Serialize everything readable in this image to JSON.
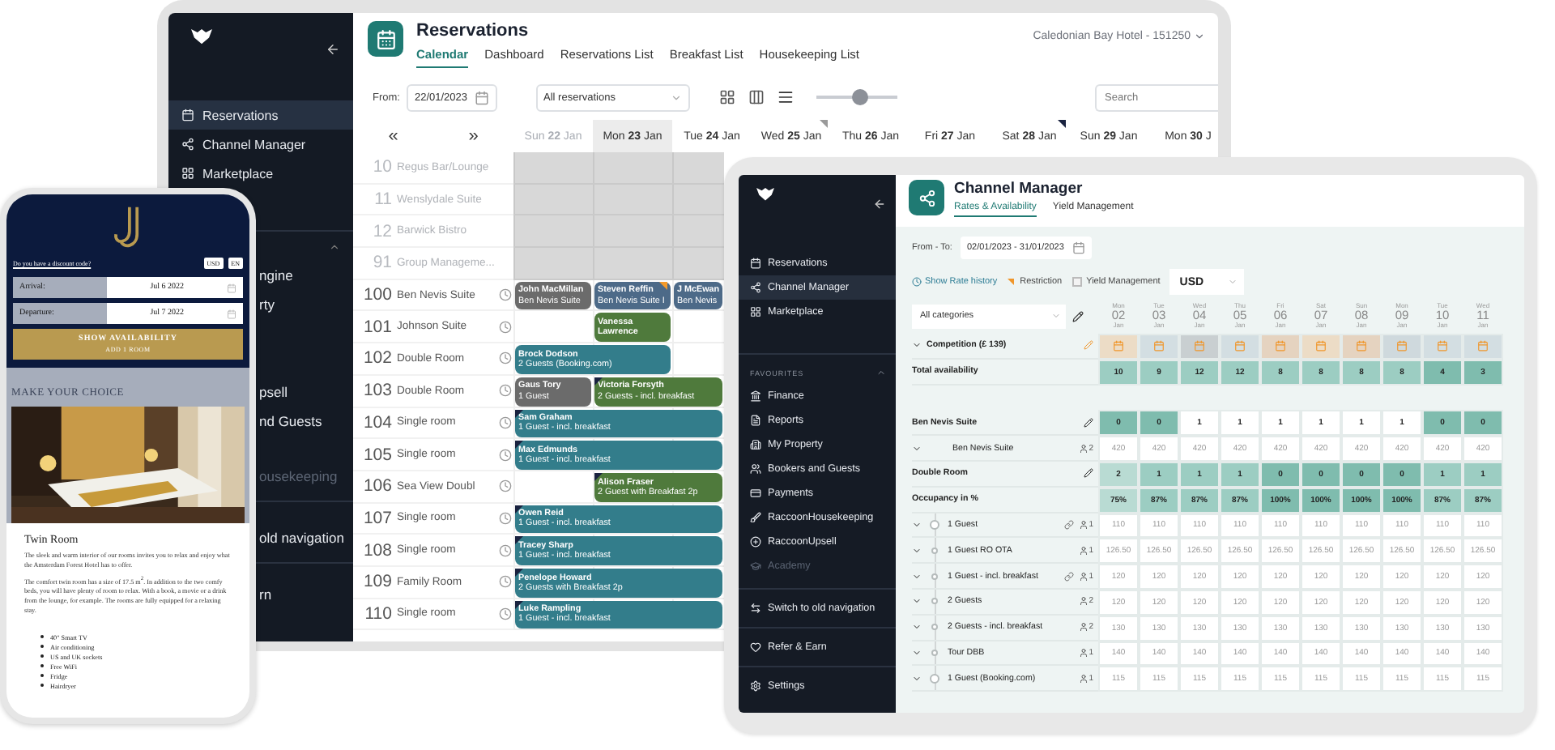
{
  "laptop": {
    "sidebar": {
      "items": [
        {
          "label": "Reservations",
          "selected": true
        },
        {
          "label": "Channel Manager",
          "selected": false
        },
        {
          "label": "Marketplace",
          "selected": false
        }
      ],
      "covered_items": [
        {
          "label": "ngine",
          "disabled": false
        },
        {
          "label": "rty",
          "disabled": false
        },
        {
          "label": "psell",
          "disabled": false
        },
        {
          "label": "nd Guests",
          "disabled": false
        },
        {
          "label": "ousekeeping",
          "disabled": true
        },
        {
          "label": "old navigation",
          "disabled": false
        },
        {
          "label": "rn",
          "disabled": false
        }
      ]
    },
    "header": {
      "title": "Reservations",
      "hotel": "Caledonian Bay Hotel - 151250",
      "tabs": [
        {
          "label": "Calendar",
          "selected": true
        },
        {
          "label": "Dashboard",
          "selected": false
        },
        {
          "label": "Reservations List",
          "selected": false
        },
        {
          "label": "Breakfast List",
          "selected": false
        },
        {
          "label": "Housekeeping List",
          "selected": false
        }
      ]
    },
    "toolbar": {
      "from_label": "From:",
      "date": "22/01/2023",
      "filter": "All reservations",
      "zoom": {
        "level": 0.55
      },
      "search": {
        "placeholder": "Search"
      }
    },
    "nav": {
      "prev": "«",
      "next": "»"
    },
    "days": [
      {
        "label": "Sun **22** Jan",
        "selected": false,
        "disabled": true
      },
      {
        "label": "Mon **23** Jan",
        "selected": true,
        "disabled": false
      },
      {
        "label": "Tue **24** Jan",
        "selected": false,
        "disabled": false
      },
      {
        "label": "Wed **25** Jan",
        "selected": false,
        "disabled": false,
        "corner": {
          "color": "#9a9a9a"
        }
      },
      {
        "label": "Thu **26** Jan",
        "selected": false,
        "disabled": false
      },
      {
        "label": "Fri **27** Jan",
        "selected": false,
        "disabled": false
      },
      {
        "label": "Sat **28** Jan",
        "selected": false,
        "disabled": false,
        "corner": {
          "color": "#1a2340"
        }
      },
      {
        "label": "Sun **29** Jan",
        "selected": false,
        "disabled": false
      },
      {
        "label": "Mon **30** J",
        "selected": false,
        "disabled": false
      }
    ],
    "rooms": [
      {
        "number": "10",
        "name": "Regus Bar/Lounge",
        "disabled": true
      },
      {
        "number": "11",
        "name": "Wenslydale Suite",
        "disabled": true
      },
      {
        "number": "12",
        "name": "Barwick Bistro",
        "disabled": true
      },
      {
        "number": "91",
        "name": "Group Manageme...",
        "disabled": true
      },
      {
        "number": "100",
        "name": "Ben Nevis Suite",
        "disabled": false,
        "bookings": [
          {
            "guest": "John MacMillan",
            "detail": "Ben Nevis Suite",
            "color": "#6b6b6b",
            "kind": "day1",
            "two_days": false,
            "open_ended": false
          },
          {
            "guest": "Steven Reffin",
            "detail": "Ben Nevis Suite I",
            "color": "#4d6a88",
            "kind": "day2",
            "two_days": false,
            "open_ended": false,
            "flag": {
              "color": "#f39a2b"
            }
          },
          {
            "guest": "J McEwan",
            "detail": "Ben Nevis",
            "color": "#4d6a88",
            "kind": "day3"
          }
        ]
      },
      {
        "number": "101",
        "name": "Johnson Suite",
        "disabled": false,
        "bookings": [
          {
            "guest": "Vanessa Lawrence",
            "color": "#4f7a3c",
            "kind": "day2",
            "two_days": false,
            "open_ended": false
          }
        ]
      },
      {
        "number": "102",
        "name": "Double Room",
        "disabled": false,
        "bookings": [
          {
            "guest": "Brock Dodson",
            "detail": "2 Guests (Booking.com)",
            "color": "#337d8b",
            "kind": "day1",
            "two_days": true,
            "open_ended": false
          }
        ]
      },
      {
        "number": "103",
        "name": "Double Room",
        "disabled": false,
        "bookings": [
          {
            "guest": "Gaus Tory",
            "detail": "1 Guest",
            "color": "#6b6b6b",
            "kind": "day1",
            "two_days": false,
            "open_ended": false
          },
          {
            "guest": "Victoria Forsyth",
            "detail": "2 Guests - incl. breakfast",
            "color": "#4f7a3c",
            "kind": "day2",
            "open_ended": true,
            "flag": {
              "color": "#1a2340"
            }
          }
        ]
      },
      {
        "number": "104",
        "name": "Single room",
        "disabled": false,
        "bookings": [
          {
            "guest": "Sam Graham",
            "detail": "1 Guest - incl. breakfast",
            "color": "#337d8b",
            "kind": "day1",
            "open_ended": true,
            "flag": {
              "color": "#1a2340"
            }
          }
        ]
      },
      {
        "number": "105",
        "name": "Single room",
        "disabled": false,
        "bookings": [
          {
            "guest": "Max Edmunds",
            "detail": "1 Guest - incl. breakfast",
            "color": "#337d8b",
            "kind": "day1",
            "open_ended": true,
            "flag": {
              "color": "#1a2340"
            }
          }
        ]
      },
      {
        "number": "106",
        "name": "Sea View Doubl",
        "disabled": false,
        "bookings": [
          {
            "guest": "Alison Fraser",
            "detail": "2 Guest with Breakfast 2p",
            "color": "#4f7a3c",
            "kind": "day2",
            "open_ended": true,
            "flag": {
              "color": "#1a2340"
            }
          }
        ]
      },
      {
        "number": "107",
        "name": "Single room",
        "disabled": false,
        "bookings": [
          {
            "guest": "Owen Reid",
            "detail": "1 Guest - incl. breakfast",
            "color": "#337d8b",
            "kind": "day1",
            "open_ended": true,
            "flag": {
              "color": "#1a2340"
            }
          }
        ]
      },
      {
        "number": "108",
        "name": "Single room",
        "disabled": false,
        "bookings": [
          {
            "guest": "Tracey Sharp",
            "detail": "1 Guest - incl. breakfast",
            "color": "#337d8b",
            "kind": "day1",
            "open_ended": true,
            "flag": {
              "color": "#1a2340"
            }
          }
        ]
      },
      {
        "number": "109",
        "name": "Family Room",
        "disabled": false,
        "bookings": [
          {
            "guest": "Penelope Howard",
            "detail": "2 Guests with Breakfast 2p",
            "color": "#337d8b",
            "kind": "day1",
            "open_ended": true,
            "flag": {
              "color": "#1a2340"
            }
          }
        ]
      },
      {
        "number": "110",
        "name": "Single room",
        "disabled": false,
        "bookings": [
          {
            "guest": "Luke Rampling",
            "detail": "1 Guest - incl. breakfast",
            "color": "#337d8b",
            "kind": "day1",
            "open_ended": true,
            "flag": {
              "color": "#1a2340"
            }
          }
        ]
      }
    ]
  },
  "tablet": {
    "sidebar": {
      "items": [
        {
          "label": "Reservations",
          "selected": false
        },
        {
          "label": "Channel Manager",
          "selected": true
        },
        {
          "label": "Marketplace",
          "selected": false
        }
      ],
      "section": "FAVOURITES",
      "favourites": [
        {
          "label": "Finance",
          "disabled": false
        },
        {
          "label": "Reports",
          "disabled": false
        },
        {
          "label": "My Property",
          "disabled": false
        },
        {
          "label": "Bookers and Guests",
          "disabled": false
        },
        {
          "label": "Payments",
          "disabled": false
        },
        {
          "label": "RaccoonHousekeeping",
          "disabled": false
        },
        {
          "label": "RaccoonUpsell",
          "disabled": false
        },
        {
          "label": "Academy",
          "disabled": true
        }
      ],
      "footer": [
        {
          "label": "Switch to old navigation"
        },
        {
          "label": "Refer & Earn"
        },
        {
          "label": "Settings"
        }
      ]
    },
    "header": {
      "title": "Channel Manager",
      "tabs": [
        {
          "label": "Rates & Availability",
          "selected": true
        },
        {
          "label": "Yield Management",
          "selected": false
        }
      ]
    },
    "filters": {
      "range_label": "From - To:",
      "range": "02/01/2023 - 31/01/2023",
      "history_link": "Show Rate history",
      "restriction": "Restriction",
      "yield": {
        "label": "Yield Management",
        "checked": false
      },
      "currency": "USD"
    },
    "table": {
      "category": "All categories",
      "days": [
        {
          "weekday": "Mon",
          "day": "02",
          "month": "Jan"
        },
        {
          "weekday": "Tue",
          "day": "03",
          "month": "Jan"
        },
        {
          "weekday": "Wed",
          "day": "04",
          "month": "Jan"
        },
        {
          "weekday": "Thu",
          "day": "05",
          "month": "Jan"
        },
        {
          "weekday": "Fri",
          "day": "06",
          "month": "Jan"
        },
        {
          "weekday": "Sat",
          "day": "07",
          "month": "Jan"
        },
        {
          "weekday": "Sun",
          "day": "08",
          "month": "Jan"
        },
        {
          "weekday": "Mon",
          "day": "09",
          "month": "Jan"
        },
        {
          "weekday": "Tue",
          "day": "10",
          "month": "Jan"
        },
        {
          "weekday": "Wed",
          "day": "11",
          "month": "Jan"
        }
      ],
      "competition": {
        "label": "Competition (£ 139)",
        "cells": [
          {
            "color": "#ecdcc6"
          },
          {
            "color": "#d3dee2"
          },
          {
            "color": "#c9cfd1"
          },
          {
            "color": "#d3dee2"
          },
          {
            "color": "#e5d3c0"
          },
          {
            "color": "#ecdcc6"
          },
          {
            "color": "#e5d3c0"
          },
          {
            "color": "#cfd9dd"
          },
          {
            "color": "#d3dee2"
          },
          {
            "color": "#d3dee2"
          }
        ]
      },
      "rows": [
        {
          "kind": "total",
          "label": "Total availability",
          "cells": [
            {
              "text": "10",
              "color": "#9ccdc2"
            },
            {
              "text": "9",
              "color": "#9ccdc2"
            },
            {
              "text": "12",
              "color": "#9ccdc2"
            },
            {
              "text": "12",
              "color": "#9ccdc2"
            },
            {
              "text": "8",
              "color": "#9ccdc2"
            },
            {
              "text": "8",
              "color": "#9ccdc2"
            },
            {
              "text": "8",
              "color": "#9ccdc2"
            },
            {
              "text": "8",
              "color": "#9ccdc2"
            },
            {
              "text": "4",
              "color": "#7fbcae"
            },
            {
              "text": "3",
              "color": "#7fbcae"
            }
          ]
        },
        {
          "kind": "room",
          "label": "Ben Nevis Suite",
          "cells": [
            {
              "text": "0",
              "color": "#7fbcae"
            },
            {
              "text": "0",
              "color": "#7fbcae"
            },
            {
              "text": "1",
              "color": "#ffffff"
            },
            {
              "text": "1",
              "color": "#ffffff"
            },
            {
              "text": "1",
              "color": "#ffffff"
            },
            {
              "text": "1",
              "color": "#ffffff"
            },
            {
              "text": "1",
              "color": "#ffffff"
            },
            {
              "text": "1",
              "color": "#ffffff"
            },
            {
              "text": "0",
              "color": "#7fbcae"
            },
            {
              "text": "0",
              "color": "#7fbcae"
            }
          ]
        },
        {
          "kind": "room_rate",
          "label": "Ben Nevis Suite",
          "guests": "2",
          "cells": [
            "420",
            "420",
            "420",
            "420",
            "420",
            "420",
            "420",
            "420",
            "420",
            "420"
          ]
        },
        {
          "kind": "room",
          "label": "Double Room",
          "cells": [
            {
              "text": "2",
              "color": "#b9dbd3"
            },
            {
              "text": "1",
              "color": "#9ccdc2"
            },
            {
              "text": "1",
              "color": "#9ccdc2"
            },
            {
              "text": "1",
              "color": "#9ccdc2"
            },
            {
              "text": "0",
              "color": "#7fbcae"
            },
            {
              "text": "0",
              "color": "#7fbcae"
            },
            {
              "text": "0",
              "color": "#7fbcae"
            },
            {
              "text": "0",
              "color": "#7fbcae"
            },
            {
              "text": "1",
              "color": "#9ccdc2"
            },
            {
              "text": "1",
              "color": "#9ccdc2"
            }
          ]
        },
        {
          "kind": "occupancy",
          "label": "Occupancy in %",
          "cells": [
            {
              "text": "75%",
              "color": "#b9dbd3"
            },
            {
              "text": "87%",
              "color": "#9ccdc2"
            },
            {
              "text": "87%",
              "color": "#9ccdc2"
            },
            {
              "text": "87%",
              "color": "#9ccdc2"
            },
            {
              "text": "100%",
              "color": "#7fbcae"
            },
            {
              "text": "100%",
              "color": "#7fbcae"
            },
            {
              "text": "100%",
              "color": "#7fbcae"
            },
            {
              "text": "100%",
              "color": "#7fbcae"
            },
            {
              "text": "87%",
              "color": "#9ccdc2"
            },
            {
              "text": "87%",
              "color": "#9ccdc2"
            }
          ]
        },
        {
          "kind": "rate",
          "parent": true,
          "label": "1 Guest",
          "linked": true,
          "guests": "1",
          "cells": [
            "110",
            "110",
            "110",
            "110",
            "110",
            "110",
            "110",
            "110",
            "110",
            "110"
          ]
        },
        {
          "kind": "rate",
          "parent": false,
          "label": "1 Guest RO OTA",
          "linked": false,
          "guests": "1",
          "cells": [
            "126.50",
            "126.50",
            "126.50",
            "126.50",
            "126.50",
            "126.50",
            "126.50",
            "126.50",
            "126.50",
            "126.50"
          ]
        },
        {
          "kind": "rate",
          "parent": false,
          "label": "1 Guest - incl. breakfast",
          "linked": true,
          "guests": "1",
          "cells": [
            "120",
            "120",
            "120",
            "120",
            "120",
            "120",
            "120",
            "120",
            "120",
            "120"
          ]
        },
        {
          "kind": "rate",
          "parent": false,
          "label": "2 Guests",
          "linked": false,
          "guests": "2",
          "cells": [
            "120",
            "120",
            "120",
            "120",
            "120",
            "120",
            "120",
            "120",
            "120",
            "120"
          ]
        },
        {
          "kind": "rate",
          "parent": false,
          "label": "2 Guests - incl. breakfast",
          "linked": false,
          "guests": "2",
          "cells": [
            "130",
            "130",
            "130",
            "130",
            "130",
            "130",
            "130",
            "130",
            "130",
            "130"
          ]
        },
        {
          "kind": "rate",
          "parent": false,
          "label": "Tour DBB",
          "linked": false,
          "guests": "1",
          "cells": [
            "140",
            "140",
            "140",
            "140",
            "140",
            "140",
            "140",
            "140",
            "140",
            "140"
          ]
        },
        {
          "kind": "rate",
          "parent": true,
          "label": "1 Guest (Booking.com)",
          "linked": false,
          "guests": "1",
          "cells": [
            "115",
            "115",
            "115",
            "115",
            "115",
            "115",
            "115",
            "115",
            "115",
            "115"
          ]
        }
      ]
    }
  },
  "phone": {
    "discount_link": "Do you have a discount code?",
    "currency": "USD",
    "language": "EN",
    "fields": [
      {
        "label": "Arrival:",
        "value": "Jul 6 2022"
      },
      {
        "label": "Departure:",
        "value": "Jul 7 2022"
      }
    ],
    "cta": {
      "label": "SHOW AVAILABILITY",
      "sub": "ADD 1 ROOM"
    },
    "section": "MAKE YOUR CHOICE",
    "room": {
      "title": "Twin Room",
      "paragraphs": [
        "The sleek and warm interior of our rooms invites you to relax and enjoy what the Amsterdam Forest Hotel has to offer.",
        "The comfort twin room has a size of 17.5 m$^{2}$. In addition to the two comfy beds, you will have plenty of room to relax. With a book, a movie or a drink from the lounge, for example. The rooms are fully equipped for a relaxing stay."
      ],
      "amenities": [
        "40\" Smart TV",
        "Air conditioning",
        "US and UK sockets",
        "Free WiFi",
        "Fridge",
        "Hairdryer"
      ]
    }
  }
}
